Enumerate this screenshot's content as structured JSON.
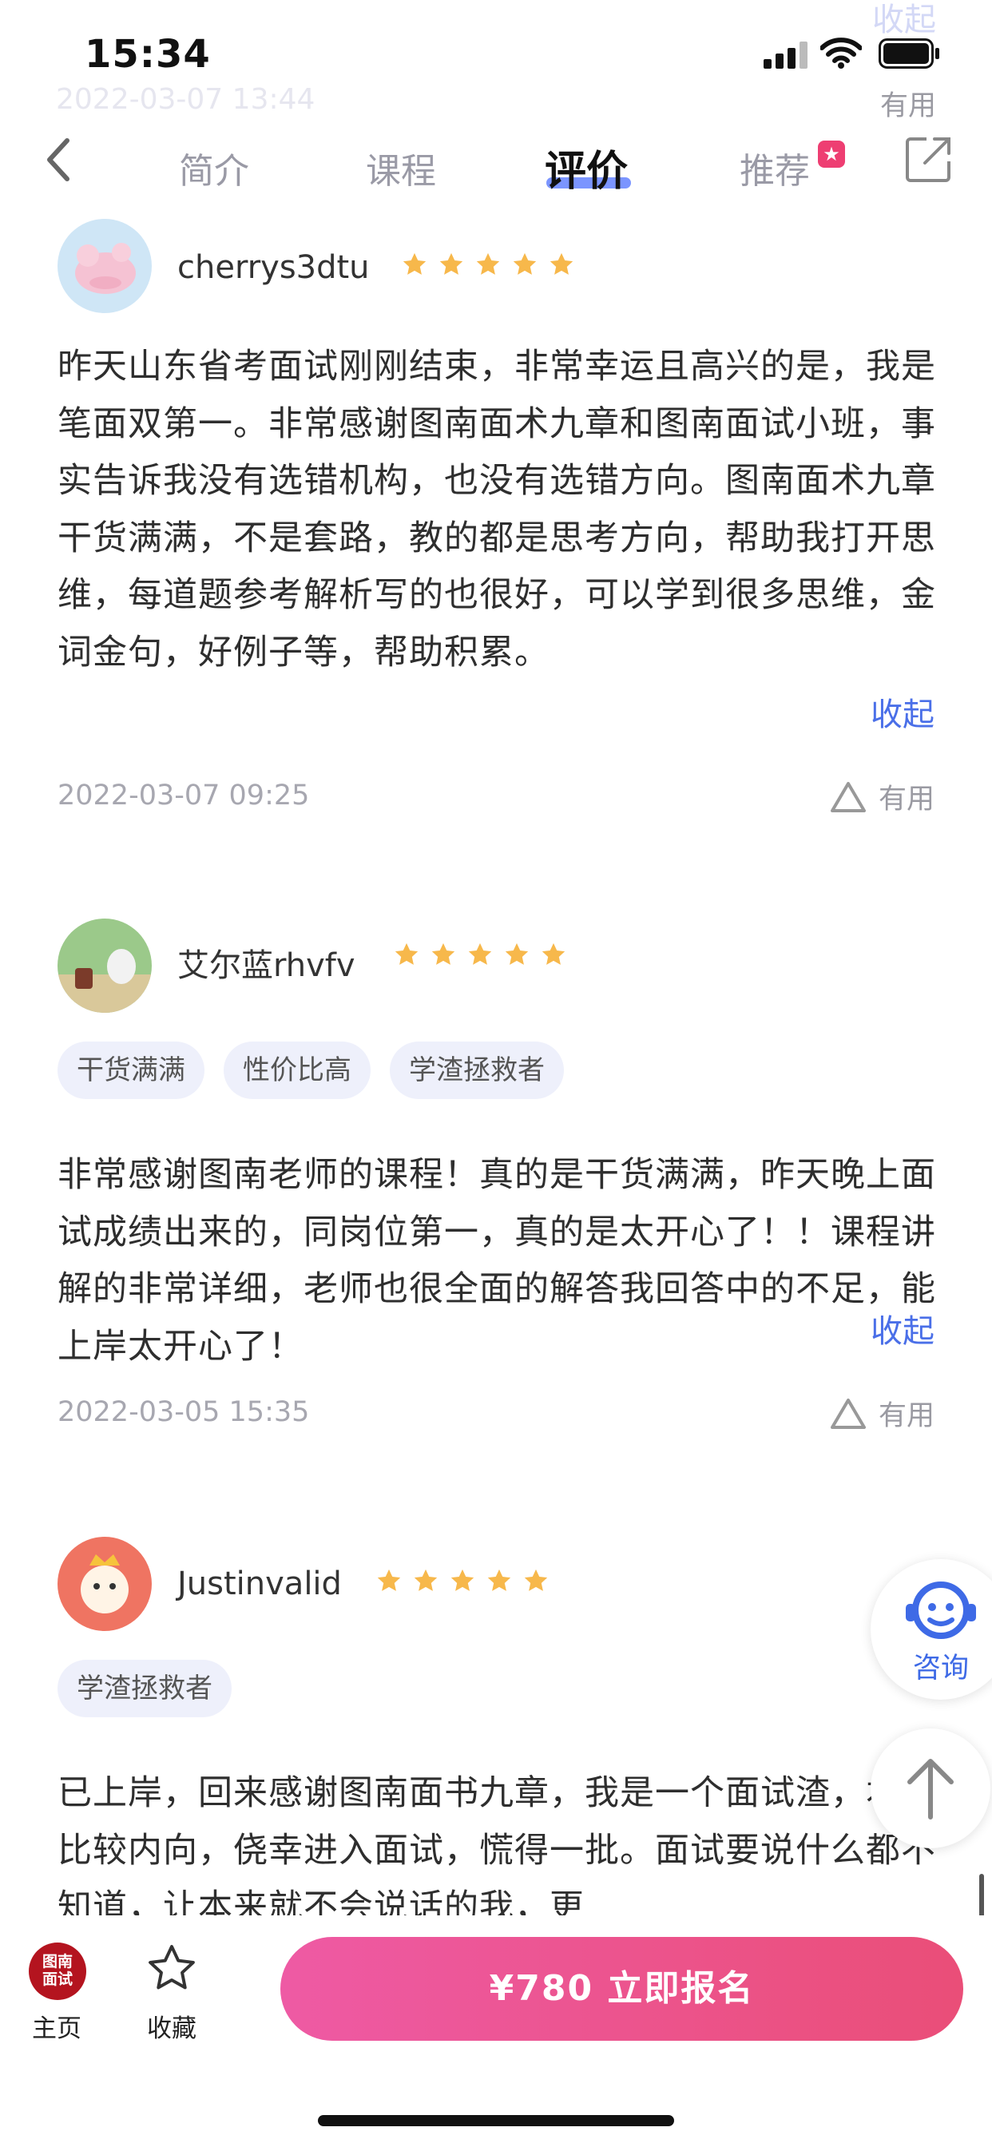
{
  "ghost": {
    "collapse": "收起",
    "date": "2022-03-07 13:44",
    "useful": "有用"
  },
  "status_bar": {
    "time": "15:34"
  },
  "nav": {
    "tabs": [
      {
        "label": "简介"
      },
      {
        "label": "课程"
      },
      {
        "label": "评价",
        "active": true
      },
      {
        "label": "推荐",
        "badge": "★"
      }
    ]
  },
  "reviews": [
    {
      "username": "cherrys3dtu",
      "rating": 5,
      "tags": [],
      "text": "昨天山东省考面试刚刚结束，非常幸运且高兴的是，我是笔面双第一。非常感谢图南面术九章和图南面试小班，事实告诉我没有选错机构，也没有选错方向。图南面术九章干货满满，不是套路，教的都是思考方向，帮助我打开思维，每道题参考解析写的也很好，可以学到很多思维，金词金句，好例子等，帮助积累。",
      "collapse_label": "收起",
      "date": "2022-03-07 09:25",
      "useful_label": "有用"
    },
    {
      "username": "艾尔蓝rhvfv",
      "rating": 5,
      "tags": [
        "干货满满",
        "性价比高",
        "学渣拯救者"
      ],
      "text": "非常感谢图南老师的课程！真的是干货满满，昨天晚上面试成绩出来的，同岗位第一，真的是太开心了！！课程讲解的非常详细，老师也很全面的解答我回答中的不足，能上岸太开心了！",
      "collapse_label": "收起",
      "date": "2022-03-05 15:35",
      "useful_label": "有用"
    },
    {
      "username": "Justinvalid",
      "rating": 5,
      "tags": [
        "学渣拯救者"
      ],
      "text": "已上岸，回来感谢图南面书九章，我是一个面试渣，本人比较内向，侥幸进入面试，慌得一批。面试要说什么都不知道，让本来就不会说话的我，更"
    }
  ],
  "float": {
    "consult_label": "咨询"
  },
  "bottom_bar": {
    "home_logo_line1": "图南",
    "home_logo_line2": "面试",
    "home_label": "主页",
    "fav_label": "收藏",
    "cta_label": "¥780 立即报名"
  },
  "colors": {
    "accent": "#4a6fe8",
    "star": "#f7b84b",
    "cta_start": "#ee5aa4",
    "cta_end": "#ea4e78",
    "tag_bg": "#eef0fb"
  }
}
